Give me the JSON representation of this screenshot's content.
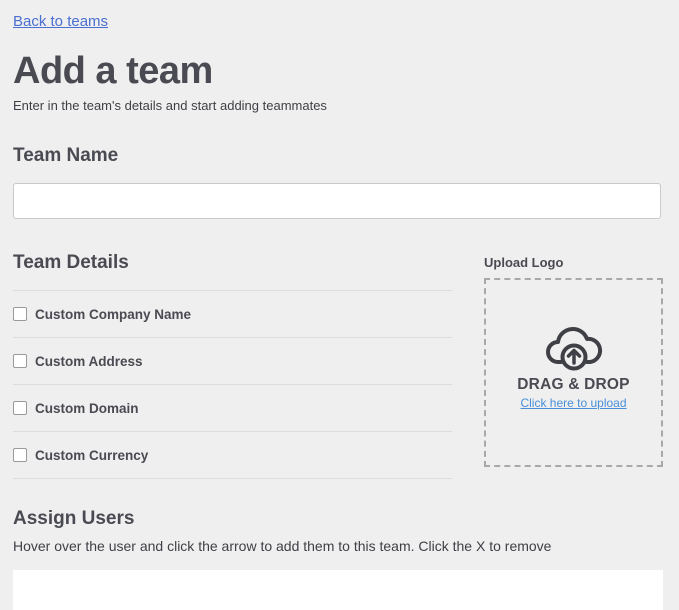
{
  "nav": {
    "back_label": "Back to teams"
  },
  "header": {
    "title": "Add a team",
    "subtitle": "Enter in the team's details and start adding teammates"
  },
  "team_name": {
    "heading": "Team Name",
    "value": "",
    "placeholder": ""
  },
  "team_details": {
    "heading": "Team Details",
    "options": [
      {
        "label": "Custom Company Name",
        "checked": false
      },
      {
        "label": "Custom Address",
        "checked": false
      },
      {
        "label": "Custom Domain",
        "checked": false
      },
      {
        "label": "Custom Currency",
        "checked": false
      }
    ]
  },
  "upload": {
    "heading": "Upload Logo",
    "icon": "cloud-upload-icon",
    "drag_text": "DRAG & DROP",
    "link_text": "Click here to upload"
  },
  "assign_users": {
    "heading": "Assign Users",
    "hint": "Hover over the user and click the arrow to add them to this team. Click the X to remove"
  }
}
